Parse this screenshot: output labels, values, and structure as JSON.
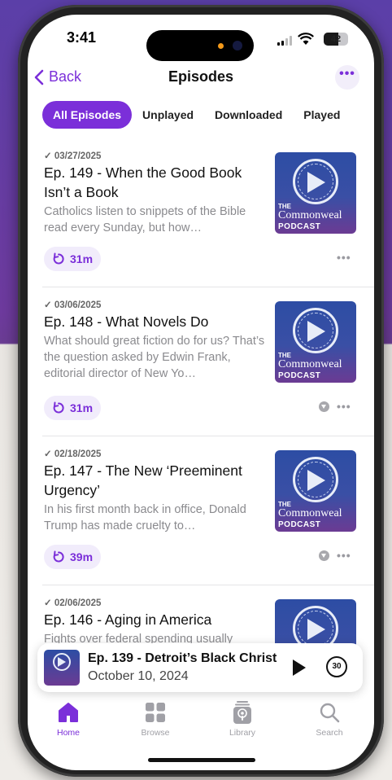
{
  "status": {
    "time": "3:41",
    "battery": "42"
  },
  "nav": {
    "back_label": "Back",
    "title": "Episodes",
    "more_label": "•••"
  },
  "filters": [
    "All Episodes",
    "Unplayed",
    "Downloaded",
    "Played"
  ],
  "episodes": [
    {
      "date": "✓ 03/27/2025",
      "title": "Ep. 149 - When the Good Book Isn’t a Book",
      "description": "Catholics listen to snippets of the Bible read every Sunday, but how…",
      "duration": "31m",
      "downloaded": false
    },
    {
      "date": "✓ 03/06/2025",
      "title": "Ep. 148 - What Novels Do",
      "description": "What should great fiction do for us? That’s the question asked by Edwin Frank,  editorial director of New Yo…",
      "duration": "31m",
      "downloaded": true
    },
    {
      "date": "✓ 02/18/2025",
      "title": "Ep. 147 - The New ‘Preeminent Urgency’",
      "description": "In his first month back in office, Donald Trump has made cruelty to…",
      "duration": "39m",
      "downloaded": true
    },
    {
      "date": "✓ 02/06/2025",
      "title": "Ep. 146 - Aging in America",
      "description": "Fights over federal spending usually",
      "duration": "",
      "downloaded": false
    }
  ],
  "artwork": {
    "line1": "THE",
    "line2": "Commonweal",
    "line3": "PODCAST"
  },
  "more_dots": "•••",
  "now_playing": {
    "title": "Ep. 139 - Detroit’s Black Christ",
    "date": "October 10, 2024",
    "skip_label": "30"
  },
  "tabs": [
    {
      "label": "Home",
      "icon": "home-icon",
      "active": true
    },
    {
      "label": "Browse",
      "icon": "grid-icon",
      "active": false
    },
    {
      "label": "Library",
      "icon": "podcast-library-icon",
      "active": false
    },
    {
      "label": "Search",
      "icon": "search-icon",
      "active": false
    }
  ],
  "colors": {
    "accent": "#7b2fd9",
    "chip_bg": "#f1ecfb"
  }
}
